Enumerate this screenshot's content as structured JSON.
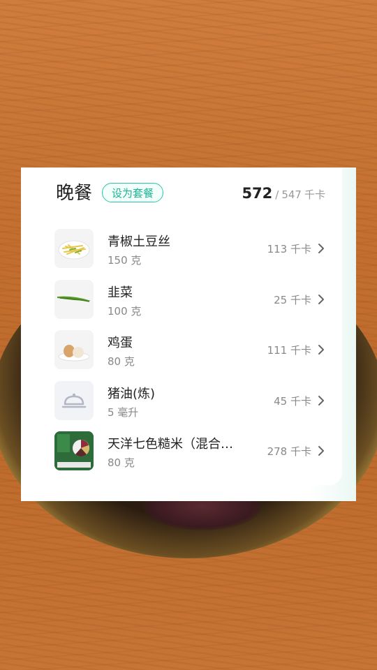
{
  "meal": {
    "title": "晚餐",
    "badge_label": "设为套餐",
    "total_kcal": "572",
    "separator": "/",
    "goal_kcal": "547",
    "unit": "千卡"
  },
  "items": [
    {
      "name": "青椒土豆丝",
      "amount": "150 克",
      "kcal": "113 千卡",
      "thumb_icon": "shredded-potato-icon"
    },
    {
      "name": "韭菜",
      "amount": "100 克",
      "kcal": "25 千卡",
      "thumb_icon": "chive-icon"
    },
    {
      "name": "鸡蛋",
      "amount": "80 克",
      "kcal": "111 千卡",
      "thumb_icon": "egg-icon"
    },
    {
      "name": "猪油(炼)",
      "amount": "5 毫升",
      "kcal": "45 千卡",
      "thumb_icon": "cloche-icon"
    },
    {
      "name": "天洋七色糙米（混合…",
      "amount": "80 克",
      "kcal": "278 千卡",
      "thumb_icon": "rice-package-icon"
    }
  ],
  "colors": {
    "accent": "#2fc4a5",
    "text_primary": "#222222",
    "text_secondary": "#888888",
    "wood": "#c46f30"
  }
}
